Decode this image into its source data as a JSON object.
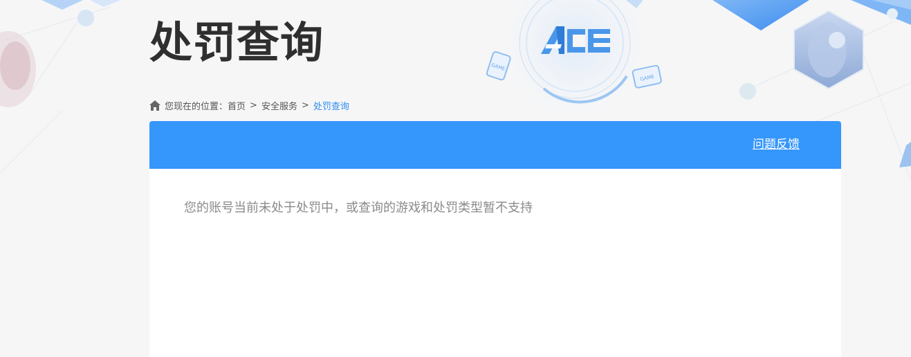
{
  "header": {
    "title": "处罚查询",
    "logo_text": "ACE",
    "device_badge_text": "GAME"
  },
  "breadcrumb": {
    "prefix": "您现在的位置：",
    "items": [
      "首页",
      "安全服务",
      "处罚查询"
    ],
    "separator": ">"
  },
  "panel": {
    "feedback_label": "问题反馈",
    "message": "您的账号当前未处于处罚中，或查询的游戏和处罚类型暂不支持"
  },
  "colors": {
    "accent": "#3596fb",
    "breadcrumb_current": "#2d8cf0",
    "title": "#2f2f2f",
    "background": "#f6f6f7"
  }
}
